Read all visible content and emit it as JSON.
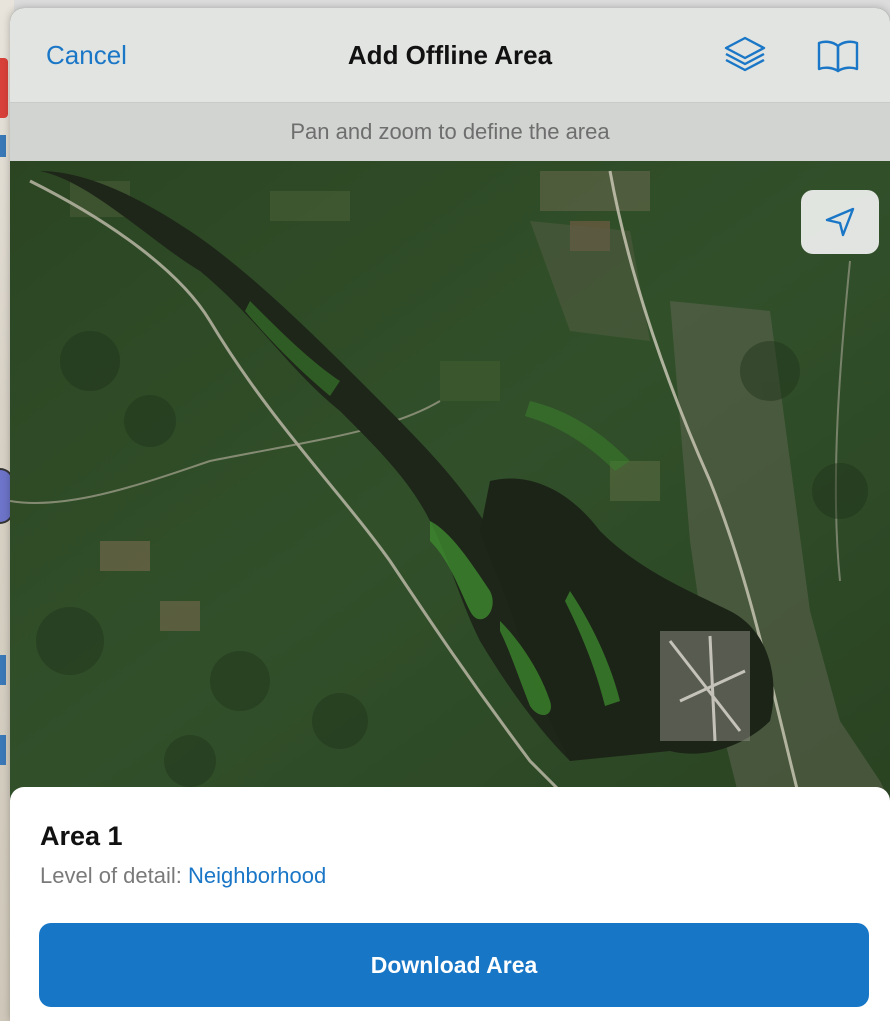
{
  "navbar": {
    "cancel_label": "Cancel",
    "title": "Add Offline Area",
    "layers_icon": "layers-icon",
    "bookmarks_icon": "book-icon"
  },
  "hint": "Pan and zoom to define the area",
  "map": {
    "type": "satellite imagery",
    "locate_icon": "location-arrow-icon"
  },
  "area": {
    "name": "Area 1",
    "detail_label": "Level of detail:",
    "detail_value": "Neighborhood"
  },
  "download_label": "Download Area",
  "colors": {
    "accent": "#1777c6",
    "link": "#1a76c6",
    "water": "#1e2619",
    "forest": "#2f4a26"
  }
}
